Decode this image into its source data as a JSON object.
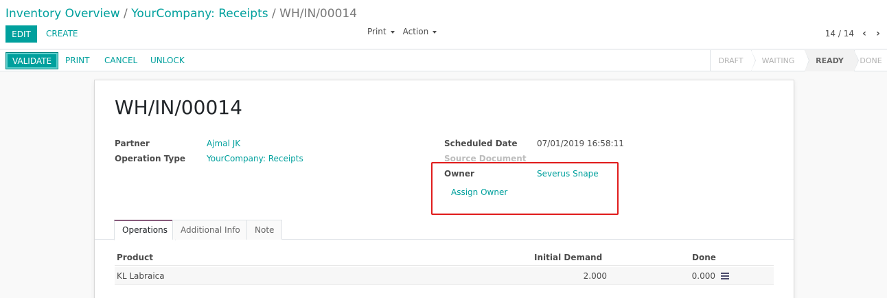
{
  "breadcrumb": {
    "items": [
      "Inventory Overview",
      "YourCompany: Receipts"
    ],
    "separator": "/",
    "current": "WH/IN/00014"
  },
  "toolbar": {
    "edit_label": "EDIT",
    "create_label": "CREATE",
    "print_label": "Print",
    "action_label": "Action"
  },
  "pager": {
    "value": "14 / 14",
    "prev_icon": "chevron-left-icon",
    "next_icon": "chevron-right-icon"
  },
  "statusbar": {
    "validate_label": "VALIDATE",
    "print_label": "PRINT",
    "cancel_label": "CANCEL",
    "unlock_label": "UNLOCK",
    "stages": [
      "DRAFT",
      "WAITING",
      "READY",
      "DONE"
    ],
    "active_stage": "READY"
  },
  "form": {
    "title": "WH/IN/00014",
    "partner_label": "Partner",
    "partner_value": "Ajmal JK",
    "operation_type_label": "Operation Type",
    "operation_type_value": "YourCompany: Receipts",
    "scheduled_date_label": "Scheduled Date",
    "scheduled_date_value": "07/01/2019 16:58:11",
    "source_document_label": "Source Document",
    "owner_label": "Owner",
    "owner_value": "Severus Snape",
    "assign_owner_label": "Assign Owner"
  },
  "tabs": [
    {
      "label": "Operations",
      "active": true
    },
    {
      "label": "Additional Info",
      "active": false
    },
    {
      "label": "Note",
      "active": false
    }
  ],
  "operations": {
    "columns": [
      "Product",
      "Initial Demand",
      "Done"
    ],
    "rows": [
      {
        "product": "KL Labraica",
        "initial_demand": "2.000",
        "done": "0.000"
      }
    ]
  },
  "colors": {
    "accent": "#00a09d",
    "highlight": "#e01b1b",
    "tab_active_border": "#875a7b"
  }
}
